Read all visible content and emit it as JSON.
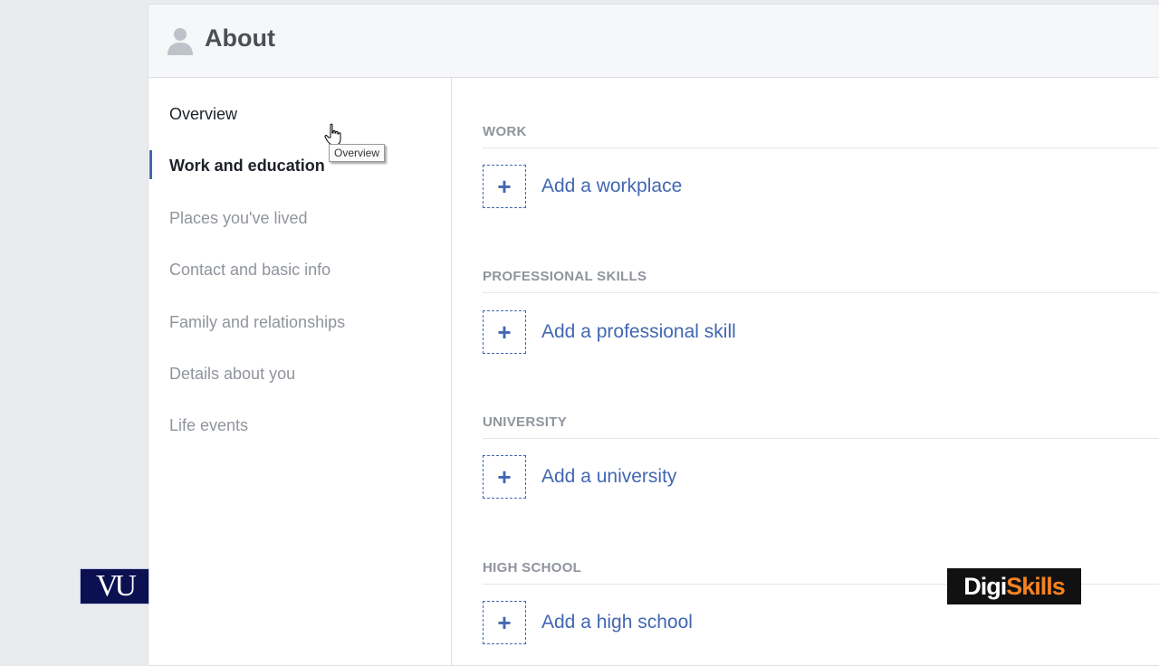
{
  "header": {
    "title": "About"
  },
  "sidebar": {
    "items": [
      {
        "label": "Overview"
      },
      {
        "label": "Work and education"
      },
      {
        "label": "Places you've lived"
      },
      {
        "label": "Contact and basic info"
      },
      {
        "label": "Family and relationships"
      },
      {
        "label": "Details about you"
      },
      {
        "label": "Life events"
      }
    ],
    "active": "Work and education"
  },
  "tooltip": {
    "text": "Overview"
  },
  "sections": [
    {
      "heading": "WORK",
      "add_label": "Add a workplace"
    },
    {
      "heading": "PROFESSIONAL SKILLS",
      "add_label": "Add a professional skill"
    },
    {
      "heading": "UNIVERSITY",
      "add_label": "Add a university"
    },
    {
      "heading": "HIGH SCHOOL",
      "add_label": "Add a high school"
    }
  ],
  "plus_symbol": "+",
  "logos": {
    "left": "VU",
    "right_part1": "Digi",
    "right_part2": "Skills"
  },
  "colors": {
    "accent": "#4267b2",
    "muted_text": "#90949c",
    "brand_orange": "#f58220"
  }
}
